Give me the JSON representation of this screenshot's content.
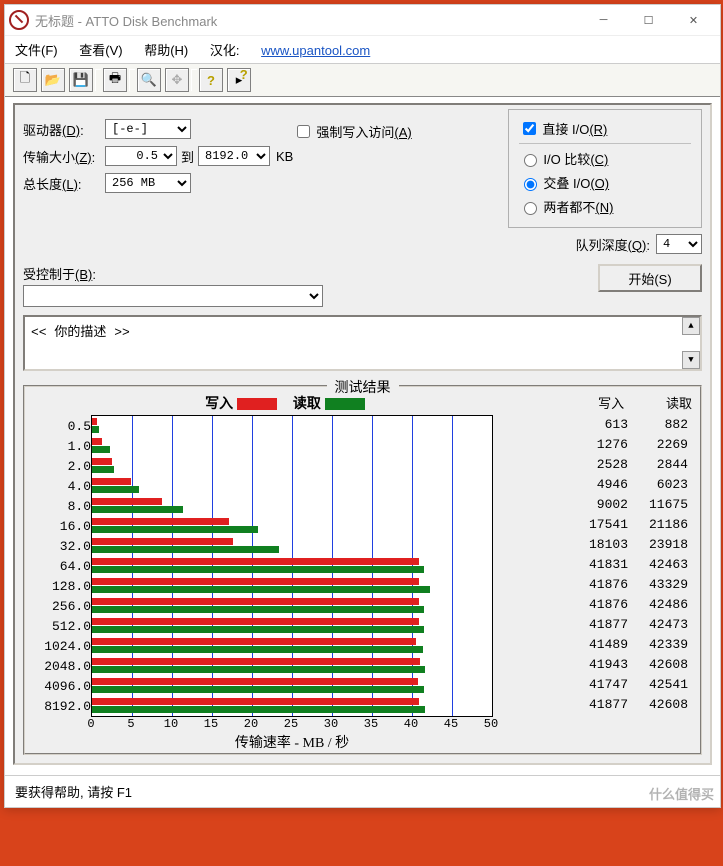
{
  "title": "无标题 - ATTO Disk Benchmark",
  "menu": {
    "file": "文件(F)",
    "view": "查看(V)",
    "help": "帮助(H)",
    "hanhua": "汉化:",
    "url": "www.upantool.com"
  },
  "cfg": {
    "drive_lbl": "驱动器",
    "drive_key": "(D)",
    "drive_val": "[-e-]",
    "xfer_lbl": "传输大小",
    "xfer_key": "(Z)",
    "xfer_from": "0.5",
    "to": "到",
    "xfer_to": "8192.0",
    "unit": "KB",
    "len_lbl": "总长度",
    "len_key": "(L)",
    "len_val": "256 MB",
    "force_lbl": "强制写入访问",
    "force_key": "(A)",
    "direct_lbl": "直接 I/O",
    "direct_key": "(R)",
    "r1": "I/O 比较",
    "r1k": "(C)",
    "r2": "交叠 I/O",
    "r2k": "(O)",
    "r3": "两者都不",
    "r3k": "(N)",
    "queue_lbl": "队列深度",
    "queue_key": "(Q)",
    "queue_val": "4",
    "ctrl_lbl": "受控制于",
    "ctrl_key": "(B)",
    "start": "开始(S)"
  },
  "desc": "<<  你的描述   >>",
  "results": {
    "title": "测试结果",
    "write": "写入",
    "read": "读取",
    "axis": "传输速率 - MB / 秒"
  },
  "axis": {
    "max": 50,
    "ticks": [
      0,
      5,
      10,
      15,
      20,
      25,
      30,
      35,
      40,
      45,
      50
    ]
  },
  "chart_data": {
    "type": "bar",
    "xlabel": "传输速率 - MB / 秒",
    "xlim": [
      0,
      50
    ],
    "series": [
      {
        "name": "写入"
      },
      {
        "name": "读取"
      }
    ],
    "rows": [
      {
        "size": "0.5",
        "write": 613,
        "read": 882,
        "write_mb": 0.6,
        "read_mb": 0.86
      },
      {
        "size": "1.0",
        "write": 1276,
        "read": 2269,
        "write_mb": 1.25,
        "read_mb": 2.22
      },
      {
        "size": "2.0",
        "write": 2528,
        "read": 2844,
        "write_mb": 2.47,
        "read_mb": 2.78
      },
      {
        "size": "4.0",
        "write": 4946,
        "read": 6023,
        "write_mb": 4.83,
        "read_mb": 5.88
      },
      {
        "size": "8.0",
        "write": 9002,
        "read": 11675,
        "write_mb": 8.79,
        "read_mb": 11.4
      },
      {
        "size": "16.0",
        "write": 17541,
        "read": 21186,
        "write_mb": 17.13,
        "read_mb": 20.69
      },
      {
        "size": "32.0",
        "write": 18103,
        "read": 23918,
        "write_mb": 17.68,
        "read_mb": 23.36
      },
      {
        "size": "64.0",
        "write": 41831,
        "read": 42463,
        "write_mb": 40.85,
        "read_mb": 41.47
      },
      {
        "size": "128.0",
        "write": 41876,
        "read": 43329,
        "write_mb": 40.89,
        "read_mb": 42.31
      },
      {
        "size": "256.0",
        "write": 41876,
        "read": 42486,
        "write_mb": 40.89,
        "read_mb": 41.49
      },
      {
        "size": "512.0",
        "write": 41877,
        "read": 42473,
        "write_mb": 40.9,
        "read_mb": 41.48
      },
      {
        "size": "1024.0",
        "write": 41489,
        "read": 42339,
        "write_mb": 40.52,
        "read_mb": 41.34
      },
      {
        "size": "2048.0",
        "write": 41943,
        "read": 42608,
        "write_mb": 40.96,
        "read_mb": 41.61
      },
      {
        "size": "4096.0",
        "write": 41747,
        "read": 42541,
        "write_mb": 40.77,
        "read_mb": 41.54
      },
      {
        "size": "8192.0",
        "write": 41877,
        "read": 42608,
        "write_mb": 40.9,
        "read_mb": 41.61
      }
    ]
  },
  "status": "要获得帮助, 请按 F1",
  "watermark": "什么值得买"
}
